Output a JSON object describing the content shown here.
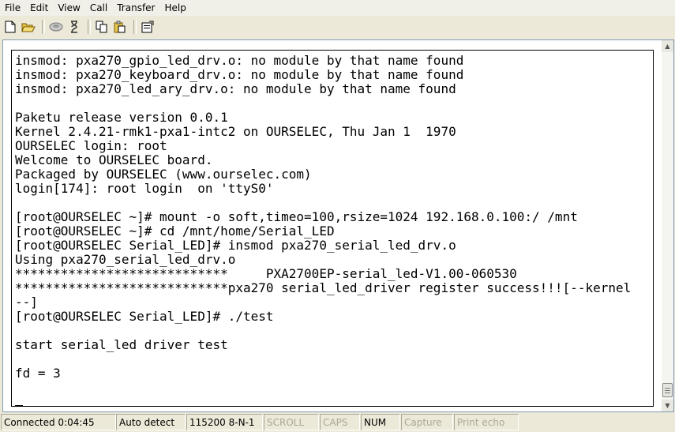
{
  "menu": [
    "File",
    "Edit",
    "View",
    "Call",
    "Transfer",
    "Help"
  ],
  "toolbar": {
    "icons": [
      "new-icon",
      "open-icon",
      "disconnect-icon",
      "properties-connect-icon",
      "copy-icon",
      "paste-icon",
      "properties-icon"
    ]
  },
  "terminal": {
    "lines": [
      "insmod: pxa270_gpio_led_drv.o: no module by that name found",
      "insmod: pxa270_keyboard_drv.o: no module by that name found",
      "insmod: pxa270_led_ary_drv.o: no module by that name found",
      "",
      "Paketu release version 0.0.1",
      "Kernel 2.4.21-rmk1-pxa1-intc2 on OURSELEC, Thu Jan 1  1970",
      "OURSELEC login: root",
      "Welcome to OURSELEC board.",
      "Packaged by OURSELEC (www.ourselec.com)",
      "login[174]: root login  on 'ttyS0'",
      "",
      "[root@OURSELEC ~]# mount -o soft,timeo=100,rsize=1024 192.168.0.100:/ /mnt",
      "[root@OURSELEC ~]# cd /mnt/home/Serial_LED",
      "[root@OURSELEC Serial_LED]# insmod pxa270_serial_led_drv.o",
      "Using pxa270_serial_led_drv.o",
      "****************************     PXA2700EP-serial_led-V1.00-060530",
      "****************************pxa270 serial_led_driver register success!!![--kernel",
      "--]",
      "[root@OURSELEC Serial_LED]# ./test",
      "",
      "start serial_led driver test",
      "",
      "fd = 3",
      ""
    ]
  },
  "status": {
    "connected": "Connected 0:04:45",
    "detect": "Auto detect",
    "port": "115200 8-N-1",
    "scroll": "SCROLL",
    "caps": "CAPS",
    "num": "NUM",
    "capture": "Capture",
    "print_echo": "Print echo"
  }
}
